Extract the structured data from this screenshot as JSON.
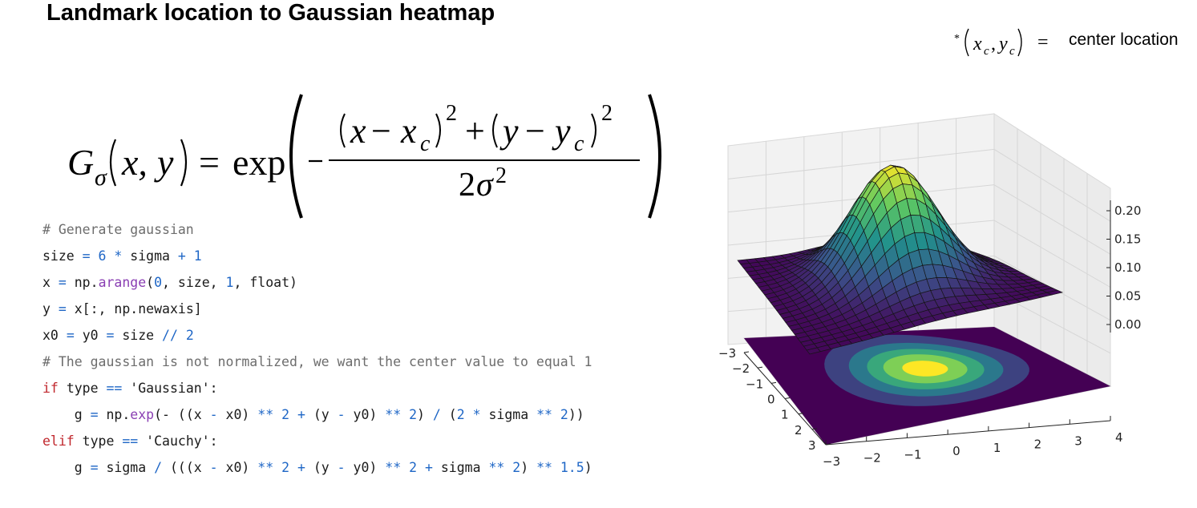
{
  "slide": {
    "title": "Landmark location to Gaussian heatmap"
  },
  "center_note": {
    "star": "*",
    "x": "x",
    "xsub": "c",
    "y": "y",
    "ysub": "c",
    "eq": "=",
    "text": "center location"
  },
  "formula": {
    "G": "G",
    "sigma": "σ",
    "args": "(x, y)",
    "eq": "=",
    "exp": "exp",
    "numerator": {
      "x": "x",
      "xc": "x",
      "c": "c",
      "y": "y",
      "yc": "y",
      "two": "2",
      "plus": "+",
      "minus": "−"
    },
    "denominator": "2σ²"
  },
  "code": {
    "line1": "# Generate gaussian",
    "line2": [
      [
        "size ",
        "t"
      ],
      [
        "= ",
        "o"
      ],
      [
        "6 ",
        "n"
      ],
      [
        "* ",
        "o"
      ],
      [
        "sigma ",
        "t"
      ],
      [
        "+ ",
        "o"
      ],
      [
        "1",
        "n"
      ]
    ],
    "line3": [
      [
        "x ",
        "t"
      ],
      [
        "= ",
        "o"
      ],
      [
        "np.",
        "t"
      ],
      [
        "arange",
        "f"
      ],
      [
        "(",
        "t"
      ],
      [
        "0",
        "n"
      ],
      [
        ", size, ",
        "t"
      ],
      [
        "1",
        "n"
      ],
      [
        ", float)",
        "t"
      ]
    ],
    "line4": [
      [
        "y ",
        "t"
      ],
      [
        "= ",
        "o"
      ],
      [
        "x[:, np.newaxis]",
        "t"
      ]
    ],
    "line5": [
      [
        "x0 ",
        "t"
      ],
      [
        "= ",
        "o"
      ],
      [
        "y0 ",
        "t"
      ],
      [
        "= ",
        "o"
      ],
      [
        "size ",
        "t"
      ],
      [
        "// ",
        "o"
      ],
      [
        "2",
        "n"
      ]
    ],
    "line6": "# The gaussian is not normalized, we want the center value to equal 1",
    "line7": [
      [
        "if ",
        "k"
      ],
      [
        "type ",
        "t"
      ],
      [
        "== ",
        "o"
      ],
      [
        "'Gaussian'",
        "s"
      ],
      [
        ":",
        "t"
      ]
    ],
    "line8": [
      [
        "    g ",
        "t"
      ],
      [
        "= ",
        "o"
      ],
      [
        "np.",
        "t"
      ],
      [
        "exp",
        "f"
      ],
      [
        "(- ((x ",
        "t"
      ],
      [
        "- ",
        "o"
      ],
      [
        "x0) ",
        "t"
      ],
      [
        "** ",
        "o"
      ],
      [
        "2 ",
        "n"
      ],
      [
        "+ ",
        "o"
      ],
      [
        "(y ",
        "t"
      ],
      [
        "- ",
        "o"
      ],
      [
        "y0) ",
        "t"
      ],
      [
        "** ",
        "o"
      ],
      [
        "2",
        "n"
      ],
      [
        ") ",
        "t"
      ],
      [
        "/ ",
        "o"
      ],
      [
        "(",
        "t"
      ],
      [
        "2 ",
        "n"
      ],
      [
        "* ",
        "o"
      ],
      [
        "sigma ",
        "t"
      ],
      [
        "** ",
        "o"
      ],
      [
        "2",
        "n"
      ],
      [
        "))",
        "t"
      ]
    ],
    "line9": [
      [
        "elif ",
        "k"
      ],
      [
        "type ",
        "t"
      ],
      [
        "== ",
        "o"
      ],
      [
        "'Cauchy'",
        "s"
      ],
      [
        ":",
        "t"
      ]
    ],
    "line10": [
      [
        "    g ",
        "t"
      ],
      [
        "= ",
        "o"
      ],
      [
        "sigma ",
        "t"
      ],
      [
        "/ ",
        "o"
      ],
      [
        "(((x ",
        "t"
      ],
      [
        "- ",
        "o"
      ],
      [
        "x0) ",
        "t"
      ],
      [
        "** ",
        "o"
      ],
      [
        "2 ",
        "n"
      ],
      [
        "+ ",
        "o"
      ],
      [
        "(y ",
        "t"
      ],
      [
        "- ",
        "o"
      ],
      [
        "y0) ",
        "t"
      ],
      [
        "** ",
        "o"
      ],
      [
        "2 ",
        "n"
      ],
      [
        "+ ",
        "o"
      ],
      [
        "sigma ",
        "t"
      ],
      [
        "** ",
        "o"
      ],
      [
        "2",
        "n"
      ],
      [
        ") ",
        "t"
      ],
      [
        "** ",
        "o"
      ],
      [
        "1.5",
        "n"
      ],
      [
        ")",
        "t"
      ]
    ]
  },
  "plot": {
    "z_ticks": [
      "0.20",
      "0.15",
      "0.10",
      "0.05",
      "0.00"
    ],
    "y_ticks": [
      "−3",
      "−2",
      "−1",
      "0",
      "1",
      "2",
      "3"
    ],
    "x_ticks": [
      "−3",
      "−2",
      "−1",
      "0",
      "1",
      "2",
      "3",
      "4"
    ],
    "colors": {
      "low": "#440154",
      "mid": "#21918c",
      "high": "#fde725"
    }
  }
}
